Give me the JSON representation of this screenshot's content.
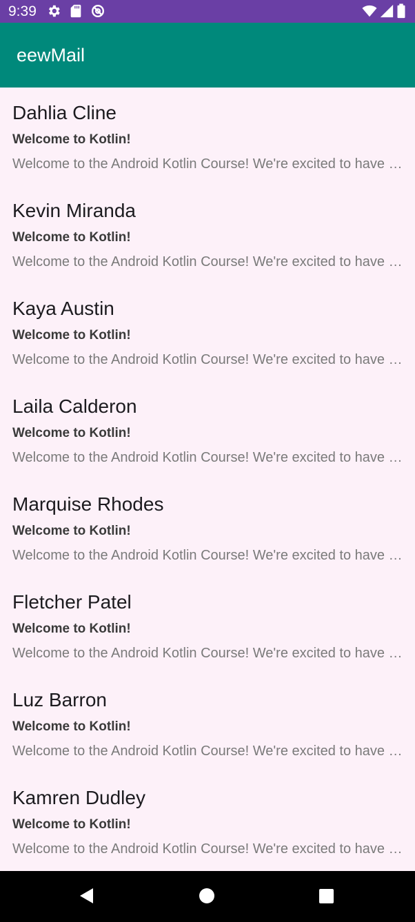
{
  "status_bar": {
    "time": "9:39",
    "icons": [
      "gear-icon",
      "sd-card-icon",
      "data-saver-icon",
      "wifi-icon",
      "cell-signal-icon",
      "battery-icon"
    ],
    "background": "#6a3fa5"
  },
  "app_bar": {
    "title": "eewMail",
    "background": "#00897b"
  },
  "emails": [
    {
      "sender": "Dahlia Cline",
      "subject": "Welcome to Kotlin!",
      "preview": "Welcome to the Android Kotlin Course! We're excited to have you join us and learn how to develop Android apps."
    },
    {
      "sender": "Kevin Miranda",
      "subject": "Welcome to Kotlin!",
      "preview": "Welcome to the Android Kotlin Course! We're excited to have you join us and learn how to develop Android apps."
    },
    {
      "sender": "Kaya Austin",
      "subject": "Welcome to Kotlin!",
      "preview": "Welcome to the Android Kotlin Course! We're excited to have you join us and learn how to develop Android apps."
    },
    {
      "sender": "Laila Calderon",
      "subject": "Welcome to Kotlin!",
      "preview": "Welcome to the Android Kotlin Course! We're excited to have you join us and learn how to develop Android apps."
    },
    {
      "sender": "Marquise Rhodes",
      "subject": "Welcome to Kotlin!",
      "preview": "Welcome to the Android Kotlin Course! We're excited to have you join us and learn how to develop Android apps."
    },
    {
      "sender": "Fletcher Patel",
      "subject": "Welcome to Kotlin!",
      "preview": "Welcome to the Android Kotlin Course! We're excited to have you join us and learn how to develop Android apps."
    },
    {
      "sender": "Luz Barron",
      "subject": "Welcome to Kotlin!",
      "preview": "Welcome to the Android Kotlin Course! We're excited to have you join us and learn how to develop Android apps."
    },
    {
      "sender": "Kamren Dudley",
      "subject": "Welcome to Kotlin!",
      "preview": "Welcome to the Android Kotlin Course! We're excited to have you join us and learn how to develop Android apps."
    }
  ],
  "nav_bar": {
    "buttons": [
      "back-icon",
      "home-icon",
      "recents-icon"
    ]
  }
}
